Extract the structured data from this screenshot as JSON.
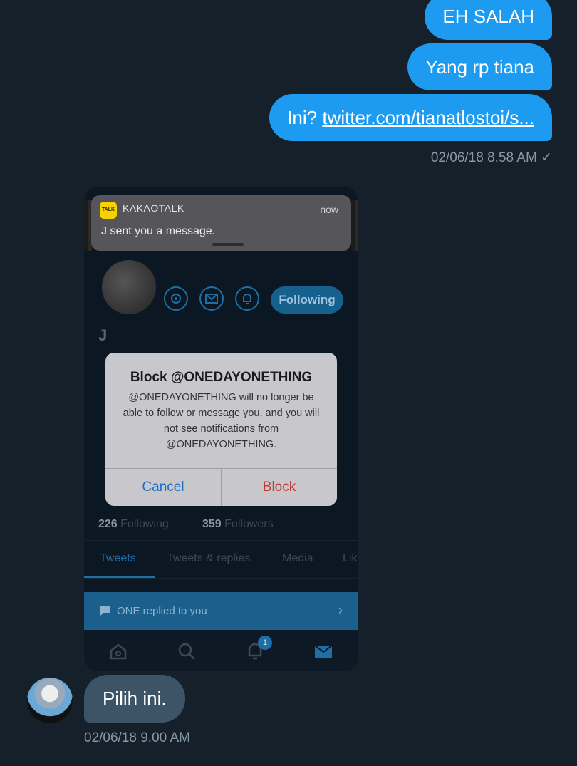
{
  "messages_out": [
    {
      "text": "EH SALAH"
    },
    {
      "text": "Yang rp tiana"
    },
    {
      "prefix": "Ini? ",
      "link": "twitter.com/tianatlostoi/s..."
    }
  ],
  "timestamp_out": "02/06/18 8.58 AM",
  "read_mark": "✓",
  "screenshot": {
    "notification": {
      "app": "KAKAOTALK",
      "time": "now",
      "message": "J sent you a message.",
      "app_icon_text": "TALK"
    },
    "profile": {
      "name": "J",
      "follow_button": "Following",
      "following_count": "226",
      "following_label": "Following",
      "followers_count": "359",
      "followers_label": "Followers"
    },
    "dialog": {
      "title": "Block @ONEDAYONETHING",
      "body": "@ONEDAYONETHING will no longer be able to follow or message you, and you will not see notifications from @ONEDAYONETHING.",
      "cancel": "Cancel",
      "confirm": "Block",
      "cancel_color": "#1a6fc7",
      "confirm_color": "#c0392b"
    },
    "tabs": [
      "Tweets",
      "Tweets & replies",
      "Media",
      "Lik"
    ],
    "reply_bar": "ONE replied to you",
    "nav_badge": "1"
  },
  "message_in": {
    "text": "Pilih ini."
  },
  "timestamp_in": "02/06/18 9.00 AM",
  "colors": {
    "background": "#15202b",
    "accent": "#1d9bf0",
    "incoming_bubble": "#3d5466"
  }
}
